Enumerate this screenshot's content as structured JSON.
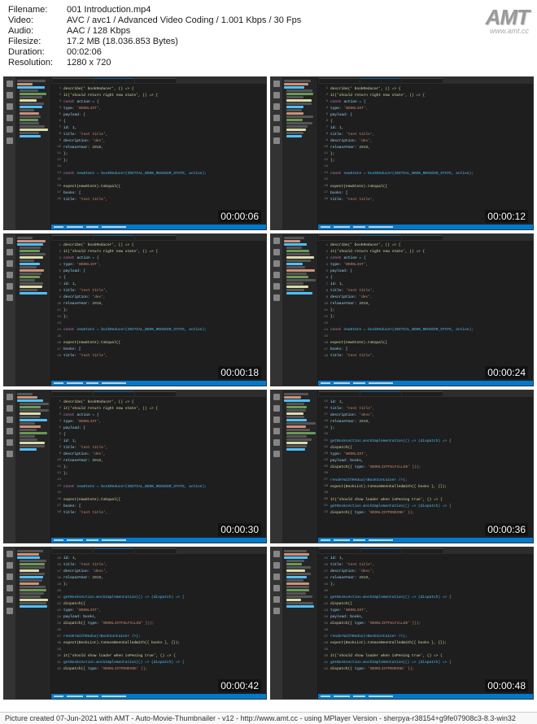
{
  "header": {
    "filename_label": "Filename:",
    "filename_value": "001 Introduction.mp4",
    "video_label": "Video:",
    "video_value": "AVC / avc1 / Advanced Video Coding / 1.001 Kbps / 30 Fps",
    "audio_label": "Audio:",
    "audio_value": "AAC / 128 Kbps",
    "filesize_label": "Filesize:",
    "filesize_value": "17.2 MB (18.036.853 Bytes)",
    "duration_label": "Duration:",
    "duration_value": "00:02:06",
    "resolution_label": "Resolution:",
    "resolution_value": "1280 x 720"
  },
  "logo": {
    "main": "AMT",
    "url": "www.amt.cc"
  },
  "thumbnails": [
    {
      "timestamp": "00:00:06",
      "variant": "a"
    },
    {
      "timestamp": "00:00:12",
      "variant": "a"
    },
    {
      "timestamp": "00:00:18",
      "variant": "a"
    },
    {
      "timestamp": "00:00:24",
      "variant": "a"
    },
    {
      "timestamp": "00:00:30",
      "variant": "a"
    },
    {
      "timestamp": "00:00:36",
      "variant": "b"
    },
    {
      "timestamp": "00:00:42",
      "variant": "b"
    },
    {
      "timestamp": "00:00:48",
      "variant": "b"
    }
  ],
  "code_content": {
    "variant_a": [
      {
        "ln": "1",
        "parts": [
          {
            "c": "func",
            "t": "describe(' bookReducer', () => {"
          }
        ]
      },
      {
        "ln": "2",
        "parts": [
          {
            "c": "func",
            "t": "  it('should return right new state', () => {"
          }
        ]
      },
      {
        "ln": "3",
        "parts": [
          {
            "c": "keyword",
            "t": "    const "
          },
          {
            "c": "var",
            "t": "action = {"
          }
        ]
      },
      {
        "ln": "4",
        "parts": [
          {
            "c": "var",
            "t": "      type: "
          },
          {
            "c": "string",
            "t": "'BOOKLIST',"
          }
        ]
      },
      {
        "ln": "5",
        "parts": [
          {
            "c": "var",
            "t": "      payload: {"
          }
        ]
      },
      {
        "ln": "6",
        "parts": [
          {
            "c": "punct",
            "t": "      {"
          }
        ]
      },
      {
        "ln": "7",
        "parts": [
          {
            "c": "var",
            "t": "        id: "
          },
          {
            "c": "num",
            "t": "1,"
          }
        ]
      },
      {
        "ln": "8",
        "parts": [
          {
            "c": "var",
            "t": "        title: "
          },
          {
            "c": "string",
            "t": "'test title',"
          }
        ]
      },
      {
        "ln": "9",
        "parts": [
          {
            "c": "var",
            "t": "        description: "
          },
          {
            "c": "string",
            "t": "'des',"
          }
        ]
      },
      {
        "ln": "10",
        "parts": [
          {
            "c": "var",
            "t": "        releaseYear: "
          },
          {
            "c": "num",
            "t": "2018,"
          }
        ]
      },
      {
        "ln": "11",
        "parts": [
          {
            "c": "punct",
            "t": "      };"
          }
        ]
      },
      {
        "ln": "12",
        "parts": [
          {
            "c": "punct",
            "t": "    };"
          }
        ]
      },
      {
        "ln": "13",
        "parts": [
          {
            "c": "punct",
            "t": ""
          }
        ]
      },
      {
        "ln": "14",
        "parts": [
          {
            "c": "keyword",
            "t": "    const "
          },
          {
            "c": "const",
            "t": "newState = bookReducer(INITIAL_BOOK_REDUCER_STATE, action);"
          }
        ]
      },
      {
        "ln": "15",
        "parts": [
          {
            "c": "punct",
            "t": ""
          }
        ]
      },
      {
        "ln": "16",
        "parts": [
          {
            "c": "func",
            "t": "    expect(newState).toEqual({"
          }
        ]
      },
      {
        "ln": "17",
        "parts": [
          {
            "c": "var",
            "t": "      books: ["
          }
        ]
      },
      {
        "ln": "18",
        "parts": [
          {
            "c": "var",
            "t": "        title: "
          },
          {
            "c": "string",
            "t": "'test title',"
          }
        ]
      }
    ],
    "variant_b": [
      {
        "ln": "15",
        "parts": [
          {
            "c": "var",
            "t": "        id: "
          },
          {
            "c": "num",
            "t": "1,"
          }
        ]
      },
      {
        "ln": "16",
        "parts": [
          {
            "c": "var",
            "t": "        title: "
          },
          {
            "c": "string",
            "t": "'test title',"
          }
        ]
      },
      {
        "ln": "17",
        "parts": [
          {
            "c": "var",
            "t": "        description: "
          },
          {
            "c": "string",
            "t": "'desc',"
          }
        ]
      },
      {
        "ln": "18",
        "parts": [
          {
            "c": "var",
            "t": "        releaseYear: "
          },
          {
            "c": "num",
            "t": "2019,"
          }
        ]
      },
      {
        "ln": "19",
        "parts": [
          {
            "c": "punct",
            "t": "    };"
          }
        ]
      },
      {
        "ln": "20",
        "parts": [
          {
            "c": "punct",
            "t": ""
          }
        ]
      },
      {
        "ln": "21",
        "parts": [
          {
            "c": "const",
            "t": "  getBooksAction.mockImplementation(() => (dispatch) => {"
          }
        ]
      },
      {
        "ln": "22",
        "parts": [
          {
            "c": "func",
            "t": "    dispatch({"
          }
        ]
      },
      {
        "ln": "23",
        "parts": [
          {
            "c": "var",
            "t": "      type: "
          },
          {
            "c": "string",
            "t": "'BOOKLIST',"
          }
        ]
      },
      {
        "ln": "24",
        "parts": [
          {
            "c": "var",
            "t": "      payload: books,"
          }
        ]
      },
      {
        "ln": "25",
        "parts": [
          {
            "c": "func",
            "t": "    dispatch({ "
          },
          {
            "c": "var",
            "t": "type: "
          },
          {
            "c": "string",
            "t": "'BOOKLISTFULFILLED' }));"
          }
        ]
      },
      {
        "ln": "26",
        "parts": [
          {
            "c": "punct",
            "t": ""
          }
        ]
      },
      {
        "ln": "27",
        "parts": [
          {
            "c": "const",
            "t": "  renderWithRedux(<BookContainer />);"
          }
        ]
      },
      {
        "ln": "28",
        "parts": [
          {
            "c": "func",
            "t": "  expect(BookList).toHaveBeenCalledWith({ books }, {});"
          }
        ]
      },
      {
        "ln": "29",
        "parts": [
          {
            "c": "punct",
            "t": ""
          }
        ]
      },
      {
        "ln": "30",
        "parts": [
          {
            "c": "func",
            "t": "  it('should show loader when isPening true', () => {"
          }
        ]
      },
      {
        "ln": "31",
        "parts": [
          {
            "c": "const",
            "t": "    getBooksAction.mockImplementation(() => (dispatch) => {"
          }
        ]
      },
      {
        "ln": "32",
        "parts": [
          {
            "c": "func",
            "t": "      dispatch({ "
          },
          {
            "c": "var",
            "t": "type: "
          },
          {
            "c": "string",
            "t": "'BOOKLISTPENDING' });"
          }
        ]
      }
    ]
  },
  "footer": {
    "text": "Picture created 07-Jun-2021 with AMT - Auto-Movie-Thumbnailer - v12 - http://www.amt.cc - using MPlayer Version - sherpya-r38154+g9fe07908c3-8.3-win32"
  }
}
